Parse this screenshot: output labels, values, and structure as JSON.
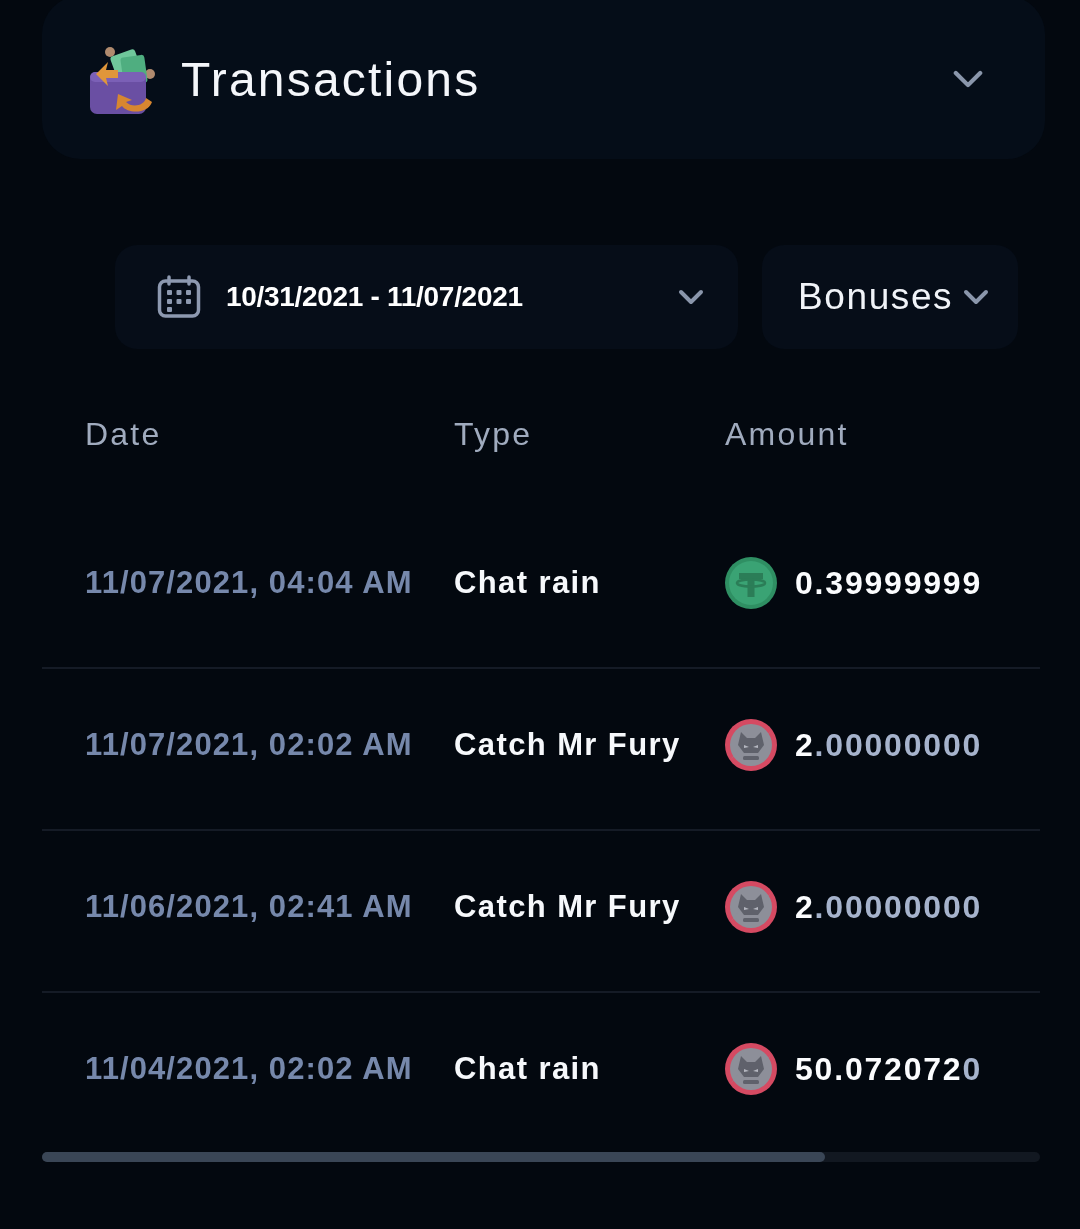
{
  "header": {
    "title": "Transactions"
  },
  "filters": {
    "date_range": "10/31/2021 - 11/07/2021",
    "category": "Bonuses"
  },
  "table": {
    "columns": [
      "Date",
      "Type",
      "Amount"
    ],
    "rows": [
      {
        "date": "11/07/2021, 04:04 AM",
        "type": "Chat rain",
        "kind": "tether",
        "amount": "0.39999999"
      },
      {
        "date": "11/07/2021, 02:02 AM",
        "type": "Catch Mr Fury",
        "kind": "bfg",
        "amount": "2.00000000"
      },
      {
        "date": "11/06/2021, 02:41 AM",
        "type": "Catch Mr Fury",
        "kind": "bfg",
        "amount": "2.00000000"
      },
      {
        "date": "11/04/2021, 02:02 AM",
        "type": "Chat rain",
        "kind": "bfg",
        "amount": "50.0720720"
      }
    ]
  }
}
